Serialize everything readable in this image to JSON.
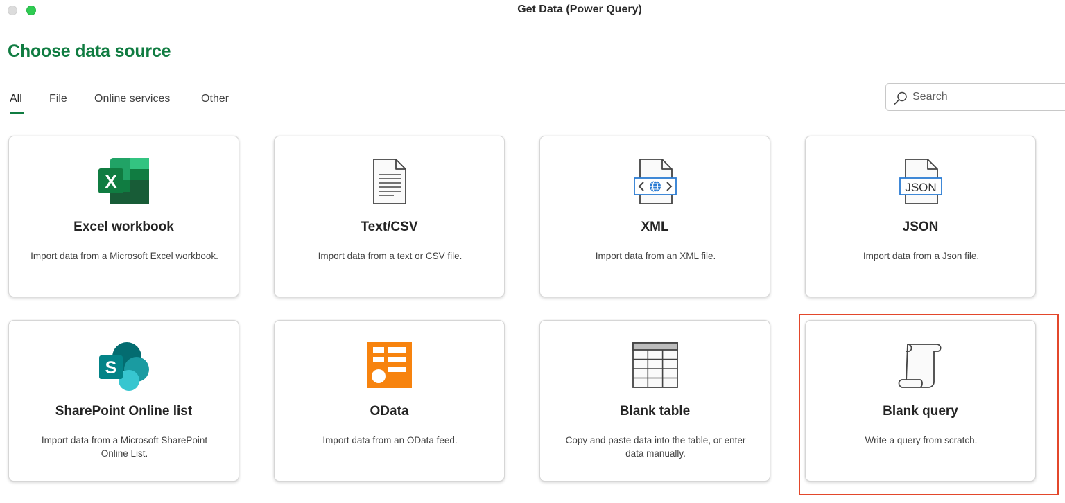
{
  "window": {
    "title": "Get Data (Power Query)"
  },
  "page_title": "Choose data source",
  "tabs": [
    {
      "label": "All",
      "active": true
    },
    {
      "label": "File",
      "active": false
    },
    {
      "label": "Online services",
      "active": false
    },
    {
      "label": "Other",
      "active": false
    }
  ],
  "search": {
    "placeholder": "Search",
    "value": ""
  },
  "cards": [
    {
      "icon": "excel-icon",
      "title": "Excel workbook",
      "description": "Import data from a Microsoft Excel workbook."
    },
    {
      "icon": "text-file-icon",
      "title": "Text/CSV",
      "description": "Import data from a text or CSV file."
    },
    {
      "icon": "xml-file-icon",
      "title": "XML",
      "description": "Import data from an XML file."
    },
    {
      "icon": "json-file-icon",
      "title": "JSON",
      "description": "Import data from a Json file."
    },
    {
      "icon": "sharepoint-icon",
      "title": "SharePoint Online list",
      "description": "Import data from a Microsoft SharePoint Online List."
    },
    {
      "icon": "odata-icon",
      "title": "OData",
      "description": "Import data from an OData feed."
    },
    {
      "icon": "blank-table-icon",
      "title": "Blank table",
      "description": "Copy and paste data into the table, or enter data manually."
    },
    {
      "icon": "blank-query-icon",
      "title": "Blank query",
      "description": "Write a query from scratch.",
      "highlighted": true
    }
  ],
  "colors": {
    "brand_green": "#107c41",
    "highlight_red": "#e3472b",
    "odata_orange": "#f7830e",
    "json_blue": "#2b7cd3"
  }
}
